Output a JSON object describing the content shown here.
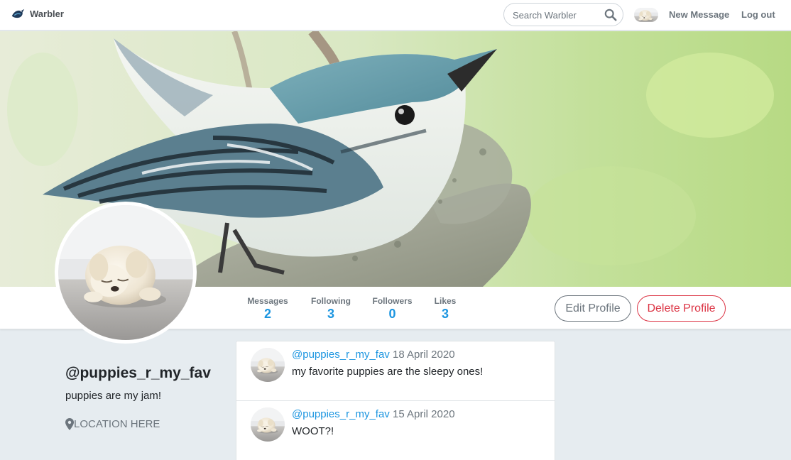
{
  "nav": {
    "brand": "Warbler",
    "search_placeholder": "Search Warbler",
    "new_message": "New Message",
    "logout": "Log out"
  },
  "stats": {
    "messages_label": "Messages",
    "messages_value": "2",
    "following_label": "Following",
    "following_value": "3",
    "followers_label": "Followers",
    "followers_value": "0",
    "likes_label": "Likes",
    "likes_value": "3"
  },
  "actions": {
    "edit": "Edit Profile",
    "delete": "Delete Profile"
  },
  "profile": {
    "username": "@puppies_r_my_fav",
    "bio": "puppies are my jam!",
    "location": "LOCATION HERE"
  },
  "messages": [
    {
      "user": "@puppies_r_my_fav",
      "date": "18 April 2020",
      "text": "my favorite puppies are the sleepy ones!"
    },
    {
      "user": "@puppies_r_my_fav",
      "date": "15 April 2020",
      "text": "WOOT?!"
    }
  ],
  "colors": {
    "link": "#1b95e0",
    "danger": "#dc3545",
    "muted": "#6c757d",
    "page_bg": "#e6ecf0"
  },
  "icons": {
    "brand": "warbler-bird-icon",
    "search": "search-icon",
    "location": "map-pin-icon"
  }
}
